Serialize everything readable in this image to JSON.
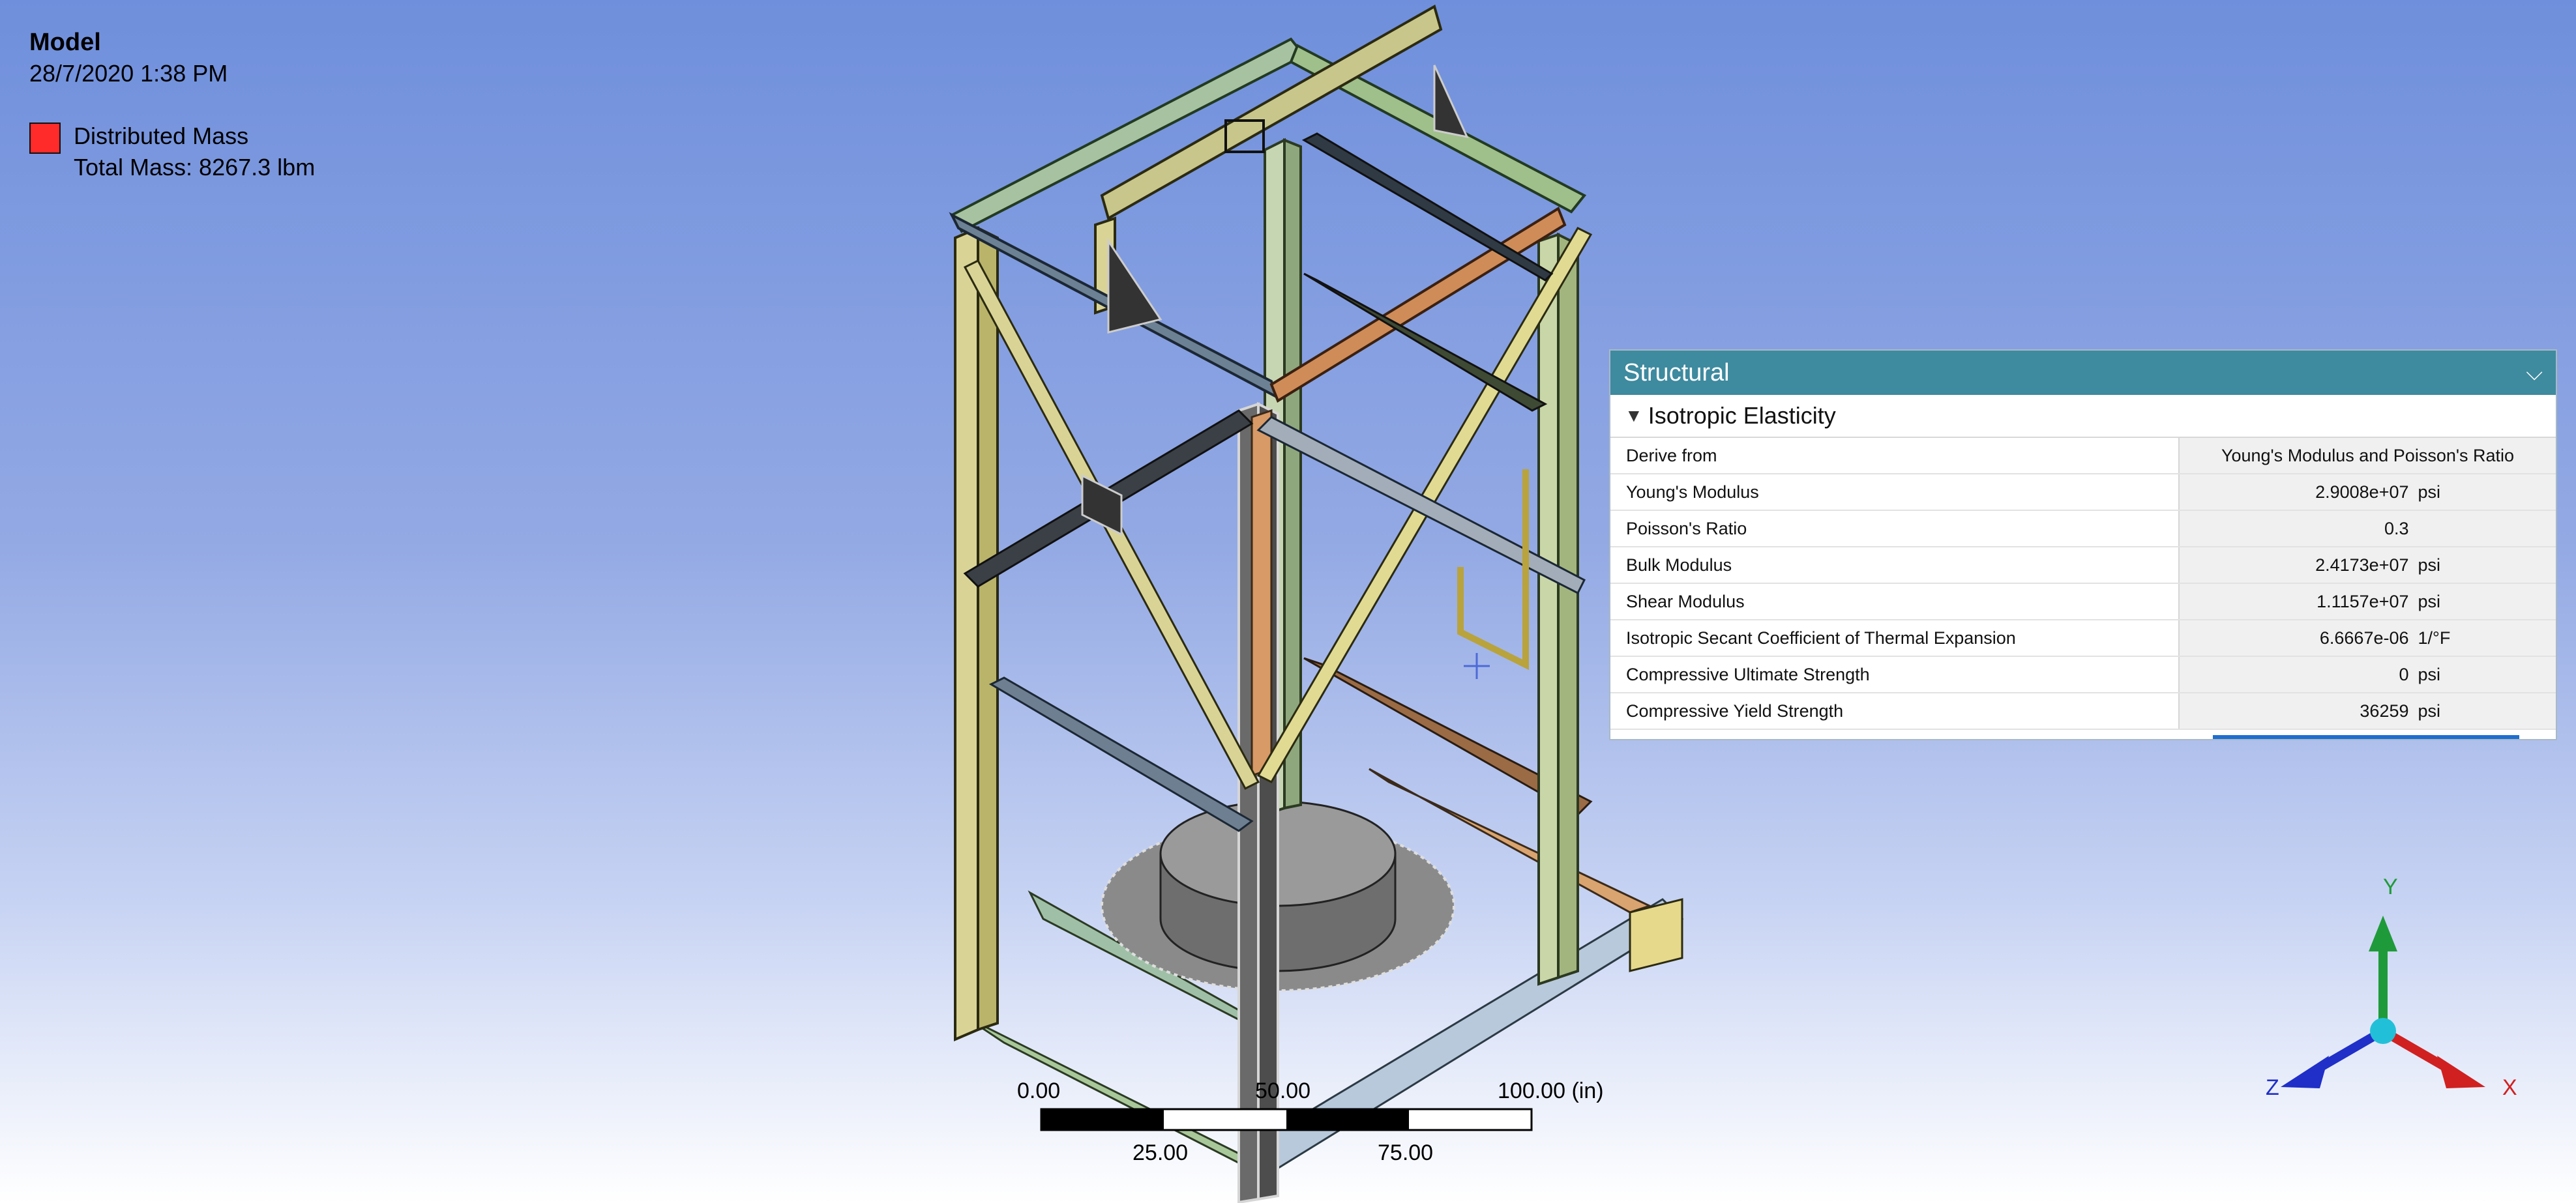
{
  "legend": {
    "title": "Model",
    "date": "28/7/2020 1:38 PM",
    "item_label": "Distributed Mass",
    "total_mass": "Total Mass: 8267.3 lbm",
    "swatch_color": "#ff2a2a"
  },
  "properties": {
    "header": "Structural",
    "section": "Isotropic Elasticity",
    "rows": [
      {
        "name": "Derive from",
        "value": "Young's Modulus and Poisson's Ratio",
        "unit": ""
      },
      {
        "name": "Young's Modulus",
        "value": "2.9008e+07",
        "unit": "psi"
      },
      {
        "name": "Poisson's Ratio",
        "value": "0.3",
        "unit": ""
      },
      {
        "name": "Bulk Modulus",
        "value": "2.4173e+07",
        "unit": "psi"
      },
      {
        "name": "Shear Modulus",
        "value": "1.1157e+07",
        "unit": "psi"
      },
      {
        "name": "Isotropic Secant Coefficient of Thermal Expansion",
        "value": "6.6667e-06",
        "unit": "1/°F"
      },
      {
        "name": "Compressive Ultimate Strength",
        "value": "0",
        "unit": "psi"
      },
      {
        "name": "Compressive Yield Strength",
        "value": "36259",
        "unit": "psi"
      }
    ],
    "header_color": "#3e8a9f"
  },
  "scale_bar": {
    "top_labels": [
      "0.00",
      "50.00",
      "100.00 (in)"
    ],
    "bottom_labels": [
      "25.00",
      "75.00"
    ]
  },
  "triad": {
    "y": "Y",
    "x": "X",
    "z": "Z",
    "colors": {
      "x": "#d02020",
      "y": "#1f9a3a",
      "z": "#1f2fc8",
      "origin": "#22c0d8"
    }
  },
  "icons": {
    "collapse": "chevron-down-icon",
    "section": "chevron-down-icon",
    "cursor": "crosshair-icon"
  }
}
